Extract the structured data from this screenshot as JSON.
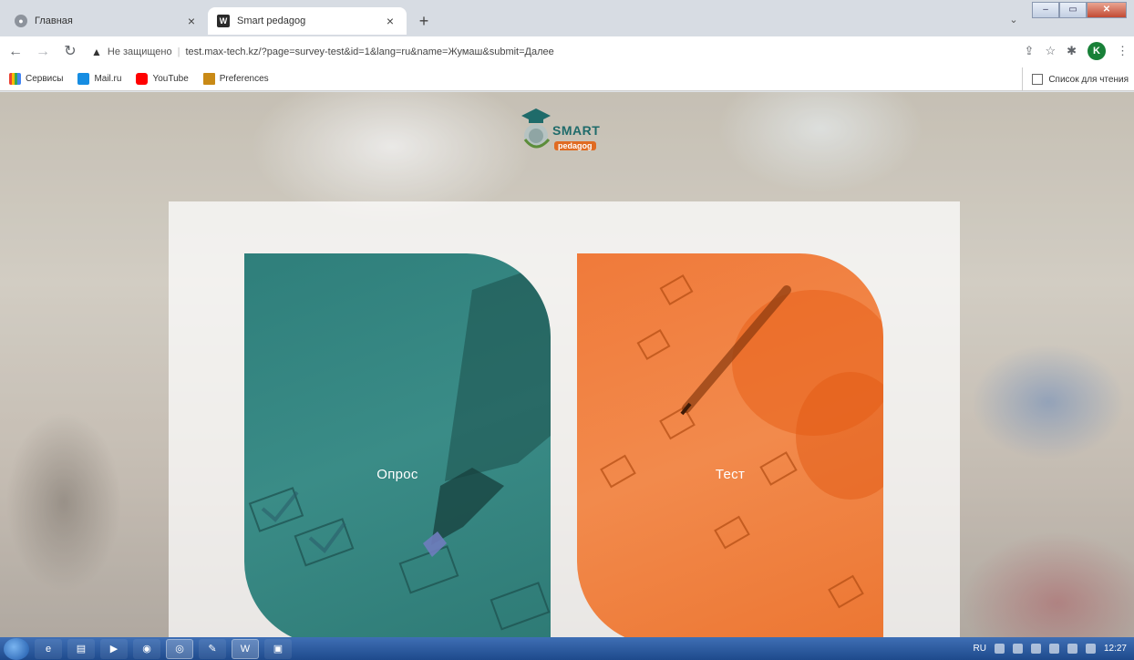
{
  "browser": {
    "tabs": [
      {
        "label": "Главная",
        "active": false
      },
      {
        "label": "Smart pedagog",
        "active": true
      }
    ],
    "new_tab_symbol": "+",
    "close_symbol": "×",
    "address": {
      "security_label": "Не защищено",
      "url": "test.max-tech.kz/?page=survey-test&id=1&lang=ru&name=Жумаш&submit=Далее"
    },
    "profile_initial": "K",
    "bookmarks": [
      {
        "label": "Сервисы",
        "icon": "apps-icon"
      },
      {
        "label": "Mail.ru",
        "icon": "mailru-icon"
      },
      {
        "label": "YouTube",
        "icon": "youtube-icon"
      },
      {
        "label": "Preferences",
        "icon": "preferences-icon"
      }
    ],
    "reading_list_label": "Список для чтения"
  },
  "page": {
    "logo": {
      "top_text": "SMART",
      "bottom_text": "pedagog"
    },
    "cards": [
      {
        "title": "Опрос",
        "color": "#2f7f7b"
      },
      {
        "title": "Тест",
        "color": "#f07a3a"
      }
    ]
  },
  "taskbar": {
    "language": "RU",
    "clock": "12:27"
  }
}
